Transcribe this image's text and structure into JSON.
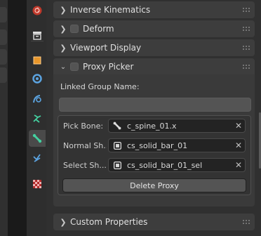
{
  "tabs": [
    {
      "icon": "world-icon"
    },
    {
      "icon": "collection-icon"
    },
    {
      "icon": "object-icon"
    },
    {
      "icon": "modifier-wrench-icon"
    },
    {
      "icon": "particles-icon"
    },
    {
      "icon": "physics-icon"
    },
    {
      "icon": "constraints-icon"
    },
    {
      "icon": "bone-icon",
      "active": true
    },
    {
      "icon": "bone-constraint-icon"
    },
    {
      "icon": "texture-icon"
    }
  ],
  "panels": {
    "inverse_kinematics": {
      "title": "Inverse Kinematics",
      "expanded": false
    },
    "deform": {
      "title": "Deform",
      "expanded": false
    },
    "viewport_display": {
      "title": "Viewport Display",
      "expanded": false
    },
    "proxy_picker": {
      "title": "Proxy Picker",
      "expanded": true,
      "linked_group_label": "Linked Group Name:",
      "linked_group_value": "",
      "pick_bone_label": "Pick Bone:",
      "pick_bone_value": "c_spine_01.x",
      "normal_shape_label": "Normal Sh...",
      "normal_shape_value": "cs_solid_bar_01",
      "select_shape_label": "Select Sh...",
      "select_shape_value": "cs_solid_bar_01_sel",
      "delete_button": "Delete Proxy"
    },
    "custom_properties": {
      "title": "Custom Properties",
      "expanded": false
    }
  },
  "colors": {
    "panel_bg": "#303030",
    "header_bg": "#3d3d3d",
    "field_bg": "#232323",
    "accent_bone": "#44d0a0"
  }
}
